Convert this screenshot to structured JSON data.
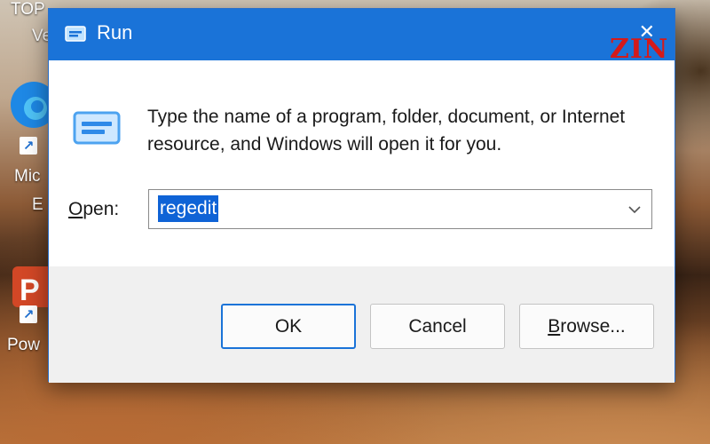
{
  "desktop": {
    "top_text_left": "TOP",
    "top_text_left2": "Ve",
    "edge_label_top": "Mic",
    "edge_label_top2": "E",
    "ppt_label": "Pow",
    "colors": {
      "edge_blue": "#1e88e5",
      "ppt_orange": "#d24726"
    }
  },
  "dialog": {
    "title": "Run",
    "close_glyph": "✕",
    "watermark": "ZIN",
    "description": "Type the name of a program, folder, document, or Internet resource, and Windows will open it for you.",
    "open_label_first": "O",
    "open_label_rest": "pen:",
    "open_value": "regedit",
    "buttons": {
      "ok": "OK",
      "cancel": "Cancel",
      "browse_first": "B",
      "browse_rest": "rowse..."
    },
    "icons": {
      "title": "run-icon",
      "body": "run-icon",
      "dropdown": "chevron-down-icon",
      "close": "close-icon"
    },
    "colors": {
      "titlebar": "#1a73d8",
      "selection": "#0f63d6",
      "footer": "#f0f0f0"
    }
  }
}
